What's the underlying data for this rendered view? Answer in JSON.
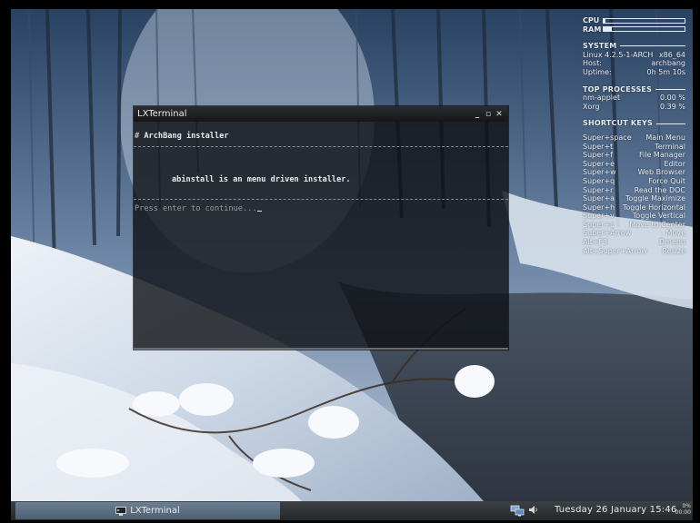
{
  "conky": {
    "cpu_label": "CPU",
    "ram_label": "RAM",
    "cpu_level": 0.02,
    "ram_level": 0.1,
    "system": {
      "heading": "SYSTEM",
      "kernel": "Linux 4.2.5-1-ARCH",
      "arch": "x86_64",
      "host_label": "Host:",
      "host": "archbang",
      "uptime_label": "Uptime:",
      "uptime": "0h 5m 10s"
    },
    "processes": {
      "heading": "TOP PROCESSES",
      "rows": [
        {
          "name": "nm-applet",
          "value": "0.00 %"
        },
        {
          "name": "Xorg",
          "value": "0.39 %"
        }
      ]
    },
    "shortcuts": {
      "heading": "SHORTCUT KEYS",
      "rows": [
        {
          "key": "Super+space",
          "action": "Main Menu"
        },
        {
          "key": "Super+t",
          "action": "Terminal"
        },
        {
          "key": "Super+f",
          "action": "File Manager"
        },
        {
          "key": "Super+e",
          "action": "Editor"
        },
        {
          "key": "Super+w",
          "action": "Web Browser"
        },
        {
          "key": "Super+q",
          "action": "Force Quit"
        },
        {
          "key": "Super+r",
          "action": "Read the DOC"
        },
        {
          "key": "Super+a",
          "action": "Toggle Maximize"
        },
        {
          "key": "Super+h",
          "action": "Toggle Horizontal"
        },
        {
          "key": "Super+v",
          "action": "Toggle Vertical"
        },
        {
          "key": "Super+c",
          "action": "Move to Center"
        },
        {
          "key": "Super+Arrow",
          "action": "Move"
        },
        {
          "key": "Alt+F3",
          "action": "Dmenu"
        },
        {
          "key": "Alt+Super+Arrow",
          "action": "Resize"
        }
      ]
    }
  },
  "terminal": {
    "title": "LXTerminal",
    "minimize": "_",
    "maximize": "▫",
    "close": "✕",
    "heading_hash": "#",
    "heading": "ArchBang installer",
    "message": "abinstall is an menu driven installer.",
    "prompt": "Press enter to continue..."
  },
  "taskbar": {
    "task_label": "LXTerminal",
    "clock": "Tuesday 26 January 15:46",
    "cpu_percent": "0%",
    "cpu_time": "00:00"
  },
  "icons": {
    "terminal": "terminal-icon",
    "network": "network-icon",
    "volume": "volume-icon"
  },
  "colors": {
    "terminal_bg": "#0e1014",
    "taskbar_active": "#5f7286",
    "text": "#e6ecf2"
  }
}
